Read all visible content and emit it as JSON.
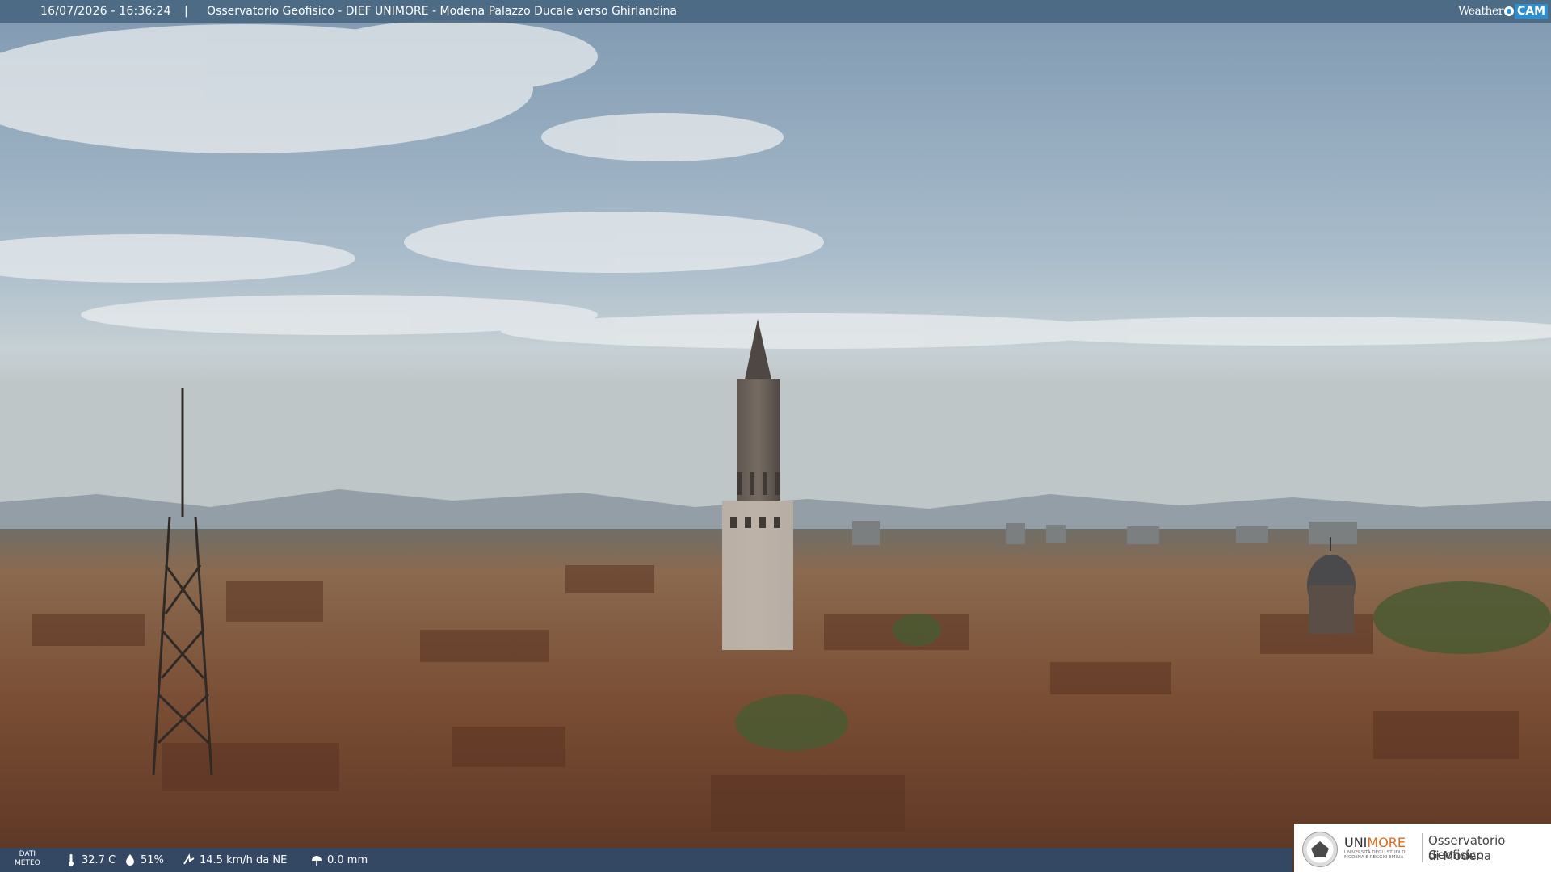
{
  "header": {
    "timestamp": "16/07/2026 - 16:36:24",
    "separator": "|",
    "title": "Osservatorio Geofisico - DIEF UNIMORE - Modena Palazzo Ducale verso Ghirlandina"
  },
  "brand": {
    "weather": "Weather",
    "cam": "CAM",
    "accent": "#2b8fd1"
  },
  "weather": {
    "label_line1": "DATI",
    "label_line2": "METEO",
    "temperature": "32.7 C",
    "humidity": "51%",
    "wind": "14.5 km/h da NE",
    "rain": "0.0 mm",
    "icons": [
      "thermometer-icon",
      "humidity-icon",
      "wind-icon",
      "rain-gauge-icon"
    ]
  },
  "footer_logo": {
    "uni_prefix": "UNI",
    "uni_suffix": "MORE",
    "uni_sub": "UNIVERSITÀ DEGLI STUDI DI MODENA E REGGIO EMILIA",
    "observatory_line1": "Osservatorio Geofisico",
    "observatory_line2": "di Modena",
    "uni_color": "#e06a1b"
  },
  "scene": {
    "subject": "Modena rooftops with Ghirlandina tower",
    "sky_color": "#9fb4c6",
    "roof_color": "#7a4a2e"
  }
}
